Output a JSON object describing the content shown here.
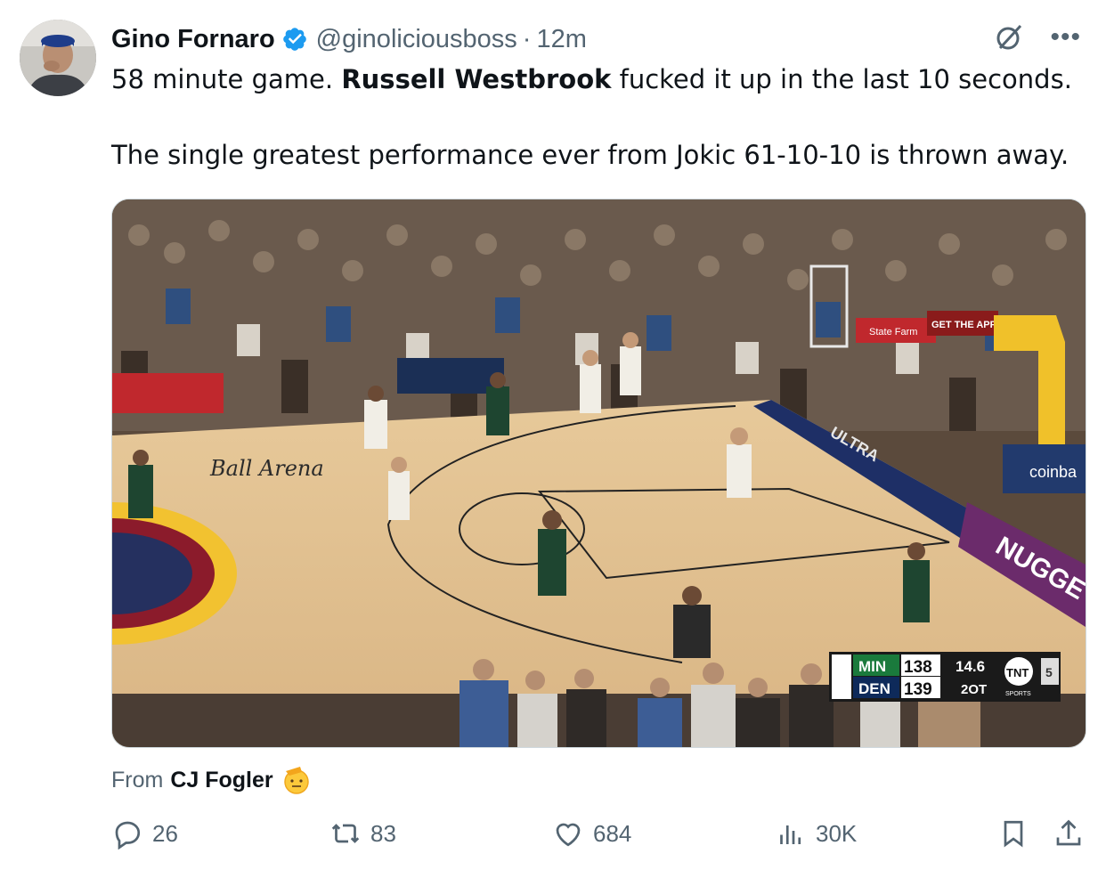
{
  "tweet": {
    "author_name": "Gino Fornaro",
    "handle": "@ginoliciousboss",
    "separator": "·",
    "time": "12m",
    "text_line1_a": "58 minute game. ",
    "text_line1_mention": "Russell Westbrook",
    "text_line1_b": " fucked it up in the last 10 seconds.",
    "text_line2": "The single greatest performance ever from Jokic 61-10-10 is thrown away."
  },
  "media": {
    "arena_logo": "Ball Arena",
    "scoreboard": {
      "team1": "MIN",
      "score1": "138",
      "team2": "DEN",
      "score2": "139",
      "clock": "14.6",
      "period": "2OT",
      "network": "TNT",
      "network_sub": "SPORTS",
      "shot_clock": "5"
    },
    "ad_coinbase": "coinba",
    "ad_nuggets": "NUGGE",
    "ad_ultra": "ULTRA",
    "ad_statefarm": "State Farm",
    "ad_app": "GET THE APP"
  },
  "source": {
    "prefix": "From",
    "name": "CJ Fogler"
  },
  "actions": {
    "replies": "26",
    "reposts": "83",
    "likes": "684",
    "views": "30K"
  },
  "icons": [
    "verified-icon",
    "grok-icon",
    "more-icon",
    "reply-icon",
    "repost-icon",
    "like-icon",
    "views-icon",
    "bookmark-icon",
    "share-icon"
  ],
  "colors": {
    "accent": "#1d9bf0",
    "muted": "#536471",
    "text": "#0f1419"
  }
}
